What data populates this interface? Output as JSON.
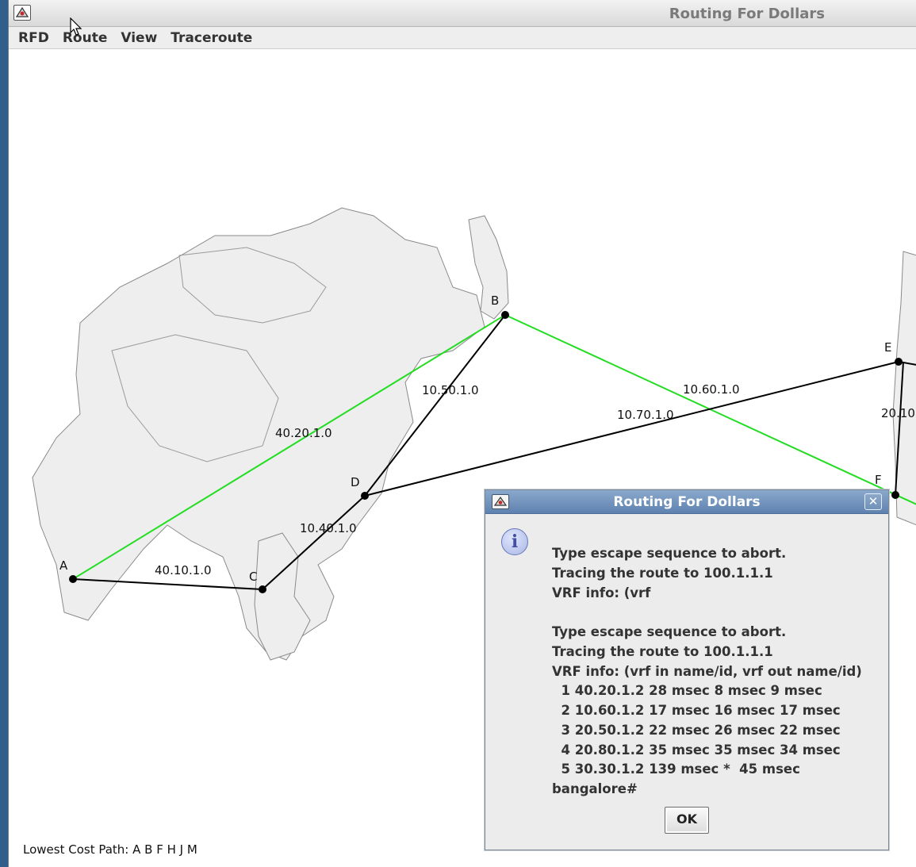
{
  "window": {
    "title": "Routing For Dollars"
  },
  "menubar": {
    "items": [
      "RFD",
      "Route",
      "View",
      "Traceroute"
    ]
  },
  "map": {
    "nodes": [
      {
        "id": "A",
        "label": "A"
      },
      {
        "id": "B",
        "label": "B"
      },
      {
        "id": "C",
        "label": "C"
      },
      {
        "id": "D",
        "label": "D"
      },
      {
        "id": "E",
        "label": "E"
      },
      {
        "id": "F",
        "label": "F"
      }
    ],
    "links": [
      {
        "from": "A",
        "to": "B",
        "label": "40.20.1.0",
        "highlighted": true
      },
      {
        "from": "B",
        "to": "F",
        "label": "10.60.1.0",
        "highlighted": true
      },
      {
        "from": "A",
        "to": "C",
        "label": "40.10.1.0",
        "highlighted": false
      },
      {
        "from": "C",
        "to": "D",
        "label": "10.40.1.0",
        "highlighted": false
      },
      {
        "from": "D",
        "to": "B",
        "label": "10.50.1.0",
        "highlighted": false
      },
      {
        "from": "D",
        "to": "E",
        "label": "10.70.1.0",
        "highlighted": false
      },
      {
        "from": "E",
        "to": "F",
        "label": "20.10",
        "highlighted": false
      }
    ],
    "colors": {
      "highlight": "#22dd22",
      "link": "#000000",
      "land": "#eeeeee",
      "coast": "#888888"
    }
  },
  "status": {
    "text": "Lowest Cost Path: A B F H J M"
  },
  "dialog": {
    "title": "Routing For Dollars",
    "close_icon": "close-icon",
    "info_glyph": "i",
    "lines": [
      "Type escape sequence to abort.",
      "Tracing the route to 100.1.1.1",
      "VRF info: (vrf",
      "",
      "Type escape sequence to abort.",
      "Tracing the route to 100.1.1.1",
      "VRF info: (vrf in name/id, vrf out name/id)",
      "  1 40.20.1.2 28 msec 8 msec 9 msec",
      "  2 10.60.1.2 17 msec 16 msec 17 msec",
      "  3 20.50.1.2 22 msec 26 msec 22 msec",
      "  4 20.80.1.2 35 msec 35 msec 34 msec",
      "  5 30.30.1.2 139 msec *  45 msec",
      "bangalore#"
    ],
    "ok_label": "OK"
  }
}
